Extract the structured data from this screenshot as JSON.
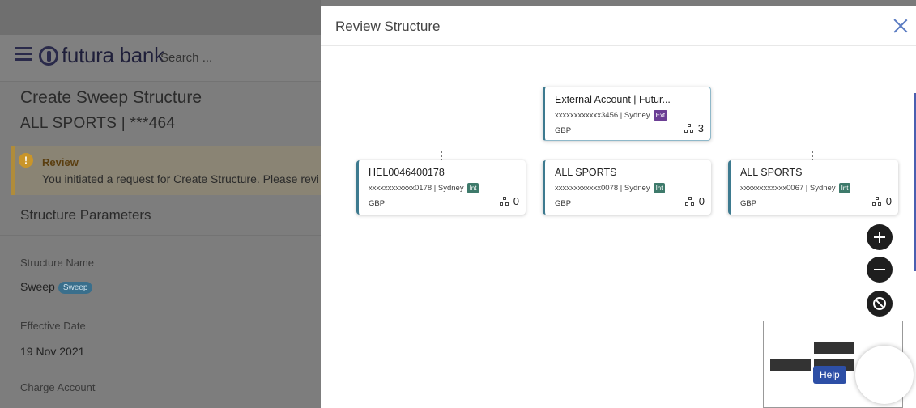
{
  "background": {
    "search_placeholder": "Search ...",
    "brand": "futura bank",
    "page_title": "Create Sweep Structure",
    "page_subtitle": "ALL SPORTS | ***464",
    "review": {
      "icon": "!",
      "title": "Review",
      "text": "You initiated a request for Create Structure. Please review th"
    },
    "section_title": "Structure Parameters",
    "fields": [
      {
        "label": "Structure Name",
        "value": "Sweep",
        "chip": "Sweep"
      },
      {
        "label": "Effective Date",
        "value": "19 Nov 2021"
      },
      {
        "label": "Charge Account",
        "value": ""
      }
    ]
  },
  "modal": {
    "title": "Review Structure",
    "root": {
      "name": "External Account | Futur...",
      "account": "xxxxxxxxxxxx3456 | Sydney",
      "tag": "Ext",
      "currency": "GBP",
      "children_count": "3"
    },
    "children": [
      {
        "name": "HEL0046400178",
        "account": "xxxxxxxxxxxx0178 | Sydney",
        "tag": "Int",
        "currency": "GBP",
        "children_count": "0"
      },
      {
        "name": "ALL SPORTS",
        "account": "xxxxxxxxxxxx0078 | Sydney",
        "tag": "Int",
        "currency": "GBP",
        "children_count": "0"
      },
      {
        "name": "ALL SPORTS",
        "account": "xxxxxxxxxxxx0067 | Sydney",
        "tag": "Int",
        "currency": "GBP",
        "children_count": "0"
      }
    ],
    "controls": {
      "zoom_in_icon": "plus-icon",
      "zoom_out_icon": "minus-icon",
      "reset_icon": "reset-icon"
    },
    "help_label": "Help"
  },
  "colors": {
    "accent": "#3d7a8f",
    "ext_tag": "#6b3e94",
    "int_tag": "#3e7a6b",
    "help": "#2d4fa6",
    "close_icon": "#5a7bc2"
  }
}
